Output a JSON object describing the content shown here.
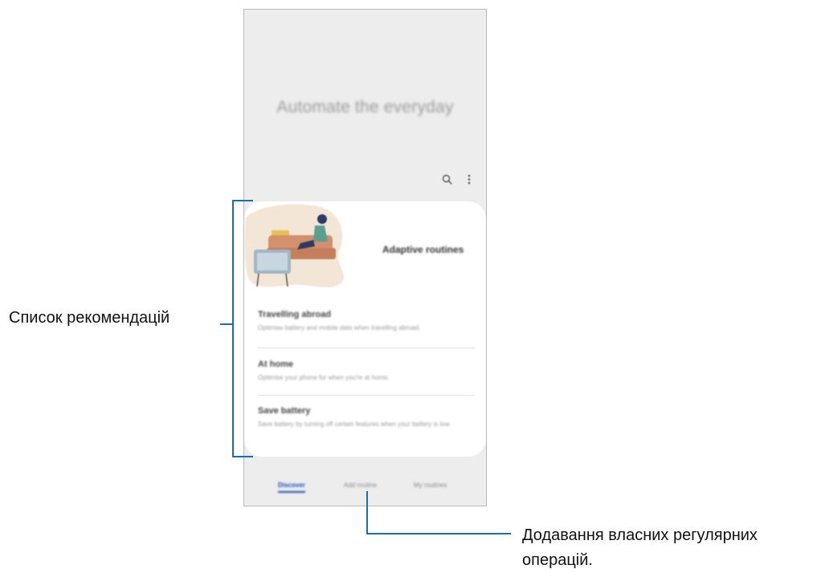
{
  "screen": {
    "hero_title": "Automate the everyday",
    "toolbar": {
      "search_icon": "search-icon",
      "menu_icon": "more-vert-icon"
    },
    "card": {
      "heading": "Adaptive routines",
      "items": [
        {
          "title": "Travelling abroad",
          "description": "Optimise battery and mobile data when travelling abroad."
        },
        {
          "title": "At home",
          "description": "Optimise your phone for when you're at home."
        },
        {
          "title": "Save battery",
          "description": "Save battery by turning off certain features when your battery is low."
        }
      ]
    },
    "tabs": [
      {
        "label": "Discover",
        "active": true
      },
      {
        "label": "Add routine",
        "active": false
      },
      {
        "label": "My routines",
        "active": false
      }
    ]
  },
  "callouts": {
    "recommendations_list": "Список рекомендацій",
    "add_custom_routines_line1": "Додавання власних регулярних",
    "add_custom_routines_line2": "операцій."
  },
  "colors": {
    "accent": "#1a4bb5",
    "callout_line": "#1a6fa8",
    "phone_bg": "#ededed",
    "card_bg": "#ffffff",
    "illustration_blob": "#f4e6d6",
    "sofa": "#d3906c"
  }
}
